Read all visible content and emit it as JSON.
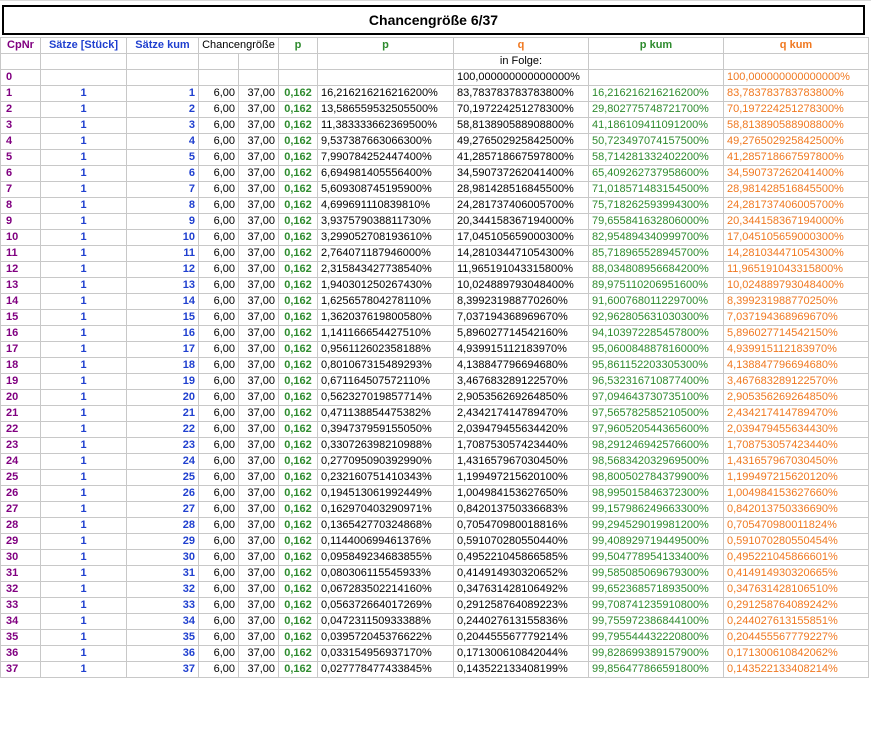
{
  "title": "Chancengröße 6/37",
  "headers": {
    "cpnr": "CpNr",
    "saetze": "Sätze [Stück]",
    "saetze_kum": "Sätze kum",
    "chancengroesse": "Chancengröße",
    "p_short": "p",
    "p": "p",
    "q": "q",
    "p_kum": "p kum",
    "q_kum": "q kum"
  },
  "in_folge": "in Folge:",
  "row0": {
    "nr": "0",
    "q": "100,000000000000000%",
    "q_kum": "100,000000000000000%"
  },
  "colors": {
    "purple": "#800080",
    "blue": "#1f3fcf",
    "green": "#2e8b2e",
    "orange": "#f07820"
  },
  "rows": [
    [
      "1",
      "1",
      "1",
      "6,00",
      "37,00",
      "0,162",
      "16,216216216216200%",
      "83,783783783783800%",
      "16,216216216216200%",
      "83,783783783783800%"
    ],
    [
      "2",
      "1",
      "2",
      "6,00",
      "37,00",
      "0,162",
      "13,586559532505500%",
      "70,197224251278300%",
      "29,802775748721700%",
      "70,197224251278300%"
    ],
    [
      "3",
      "1",
      "3",
      "6,00",
      "37,00",
      "0,162",
      "11,383333662369500%",
      "58,813890588908800%",
      "41,186109411091200%",
      "58,813890588908800%"
    ],
    [
      "4",
      "1",
      "4",
      "6,00",
      "37,00",
      "0,162",
      "9,537387663066300%",
      "49,276502925842500%",
      "50,723497074157500%",
      "49,276502925842500%"
    ],
    [
      "5",
      "1",
      "5",
      "6,00",
      "37,00",
      "0,162",
      "7,990784252447400%",
      "41,285718667597800%",
      "58,714281332402200%",
      "41,285718667597800%"
    ],
    [
      "6",
      "1",
      "6",
      "6,00",
      "37,00",
      "0,162",
      "6,694981405556400%",
      "34,590737262041400%",
      "65,409262737958600%",
      "34,590737262041400%"
    ],
    [
      "7",
      "1",
      "7",
      "6,00",
      "37,00",
      "0,162",
      "5,609308745195900%",
      "28,981428516845500%",
      "71,018571483154500%",
      "28,981428516845500%"
    ],
    [
      "8",
      "1",
      "8",
      "6,00",
      "37,00",
      "0,162",
      "4,699691110839810%",
      "24,281737406005700%",
      "75,718262593994300%",
      "24,281737406005700%"
    ],
    [
      "9",
      "1",
      "9",
      "6,00",
      "37,00",
      "0,162",
      "3,937579038811730%",
      "20,344158367194000%",
      "79,655841632806000%",
      "20,344158367194000%"
    ],
    [
      "10",
      "1",
      "10",
      "6,00",
      "37,00",
      "0,162",
      "3,299052708193610%",
      "17,045105659000300%",
      "82,954894340999700%",
      "17,045105659000300%"
    ],
    [
      "11",
      "1",
      "11",
      "6,00",
      "37,00",
      "0,162",
      "2,764071187946000%",
      "14,281034471054300%",
      "85,718965528945700%",
      "14,281034471054300%"
    ],
    [
      "12",
      "1",
      "12",
      "6,00",
      "37,00",
      "0,162",
      "2,315843427738540%",
      "11,965191043315800%",
      "88,034808956684200%",
      "11,965191043315800%"
    ],
    [
      "13",
      "1",
      "13",
      "6,00",
      "37,00",
      "0,162",
      "1,940301250267430%",
      "10,024889793048400%",
      "89,975110206951600%",
      "10,024889793048400%"
    ],
    [
      "14",
      "1",
      "14",
      "6,00",
      "37,00",
      "0,162",
      "1,625657804278110%",
      "8,399231988770260%",
      "91,600768011229700%",
      "8,399231988770250%"
    ],
    [
      "15",
      "1",
      "15",
      "6,00",
      "37,00",
      "0,162",
      "1,362037619800580%",
      "7,037194368969670%",
      "92,962805631030300%",
      "7,037194368969670%"
    ],
    [
      "16",
      "1",
      "16",
      "6,00",
      "37,00",
      "0,162",
      "1,141166654427510%",
      "5,896027714542160%",
      "94,103972285457800%",
      "5,896027714542150%"
    ],
    [
      "17",
      "1",
      "17",
      "6,00",
      "37,00",
      "0,162",
      "0,956112602358188%",
      "4,939915112183970%",
      "95,060084887816000%",
      "4,939915112183970%"
    ],
    [
      "18",
      "1",
      "18",
      "6,00",
      "37,00",
      "0,162",
      "0,801067315489293%",
      "4,138847796694680%",
      "95,861152203305300%",
      "4,138847796694680%"
    ],
    [
      "19",
      "1",
      "19",
      "6,00",
      "37,00",
      "0,162",
      "0,671164507572110%",
      "3,467683289122570%",
      "96,532316710877400%",
      "3,467683289122570%"
    ],
    [
      "20",
      "1",
      "20",
      "6,00",
      "37,00",
      "0,162",
      "0,562327019857714%",
      "2,905356269264850%",
      "97,094643730735100%",
      "2,905356269264850%"
    ],
    [
      "21",
      "1",
      "21",
      "6,00",
      "37,00",
      "0,162",
      "0,471138854475382%",
      "2,434217414789470%",
      "97,565782585210500%",
      "2,434217414789470%"
    ],
    [
      "22",
      "1",
      "22",
      "6,00",
      "37,00",
      "0,162",
      "0,394737959155050%",
      "2,039479455634420%",
      "97,960520544365600%",
      "2,039479455634430%"
    ],
    [
      "23",
      "1",
      "23",
      "6,00",
      "37,00",
      "0,162",
      "0,330726398210988%",
      "1,708753057423440%",
      "98,291246942576600%",
      "1,708753057423440%"
    ],
    [
      "24",
      "1",
      "24",
      "6,00",
      "37,00",
      "0,162",
      "0,277095090392990%",
      "1,431657967030450%",
      "98,568342032969500%",
      "1,431657967030450%"
    ],
    [
      "25",
      "1",
      "25",
      "6,00",
      "37,00",
      "0,162",
      "0,232160751410343%",
      "1,199497215620100%",
      "98,800502784379900%",
      "1,199497215620120%"
    ],
    [
      "26",
      "1",
      "26",
      "6,00",
      "37,00",
      "0,162",
      "0,194513061992449%",
      "1,004984153627650%",
      "98,995015846372300%",
      "1,004984153627660%"
    ],
    [
      "27",
      "1",
      "27",
      "6,00",
      "37,00",
      "0,162",
      "0,162970403290971%",
      "0,842013750336683%",
      "99,157986249663300%",
      "0,842013750336690%"
    ],
    [
      "28",
      "1",
      "28",
      "6,00",
      "37,00",
      "0,162",
      "0,136542770324868%",
      "0,705470980018816%",
      "99,294529019981200%",
      "0,705470980011824%"
    ],
    [
      "29",
      "1",
      "29",
      "6,00",
      "37,00",
      "0,162",
      "0,114400699461376%",
      "0,591070280550440%",
      "99,408929719449500%",
      "0,591070280550454%"
    ],
    [
      "30",
      "1",
      "30",
      "6,00",
      "37,00",
      "0,162",
      "0,095849234683855%",
      "0,495221045866585%",
      "99,504778954133400%",
      "0,495221045866601%"
    ],
    [
      "31",
      "1",
      "31",
      "6,00",
      "37,00",
      "0,162",
      "0,080306115545933%",
      "0,414914930320652%",
      "99,585085069679300%",
      "0,414914930320665%"
    ],
    [
      "32",
      "1",
      "32",
      "6,00",
      "37,00",
      "0,162",
      "0,067283502214160%",
      "0,347631428106492%",
      "99,652368571893500%",
      "0,347631428106510%"
    ],
    [
      "33",
      "1",
      "33",
      "6,00",
      "37,00",
      "0,162",
      "0,056372664017269%",
      "0,291258764089223%",
      "99,708741235910800%",
      "0,291258764089242%"
    ],
    [
      "34",
      "1",
      "34",
      "6,00",
      "37,00",
      "0,162",
      "0,047231150933388%",
      "0,244027613155836%",
      "99,755972386844100%",
      "0,244027613155851%"
    ],
    [
      "35",
      "1",
      "35",
      "6,00",
      "37,00",
      "0,162",
      "0,039572045376622%",
      "0,204455567779214%",
      "99,795544432220800%",
      "0,204455567779227%"
    ],
    [
      "36",
      "1",
      "36",
      "6,00",
      "37,00",
      "0,162",
      "0,033154956937170%",
      "0,171300610842044%",
      "99,828699389157900%",
      "0,171300610842062%"
    ],
    [
      "37",
      "1",
      "37",
      "6,00",
      "37,00",
      "0,162",
      "0,027778477433845%",
      "0,143522133408199%",
      "99,856477866591800%",
      "0,143522133408214%"
    ]
  ]
}
